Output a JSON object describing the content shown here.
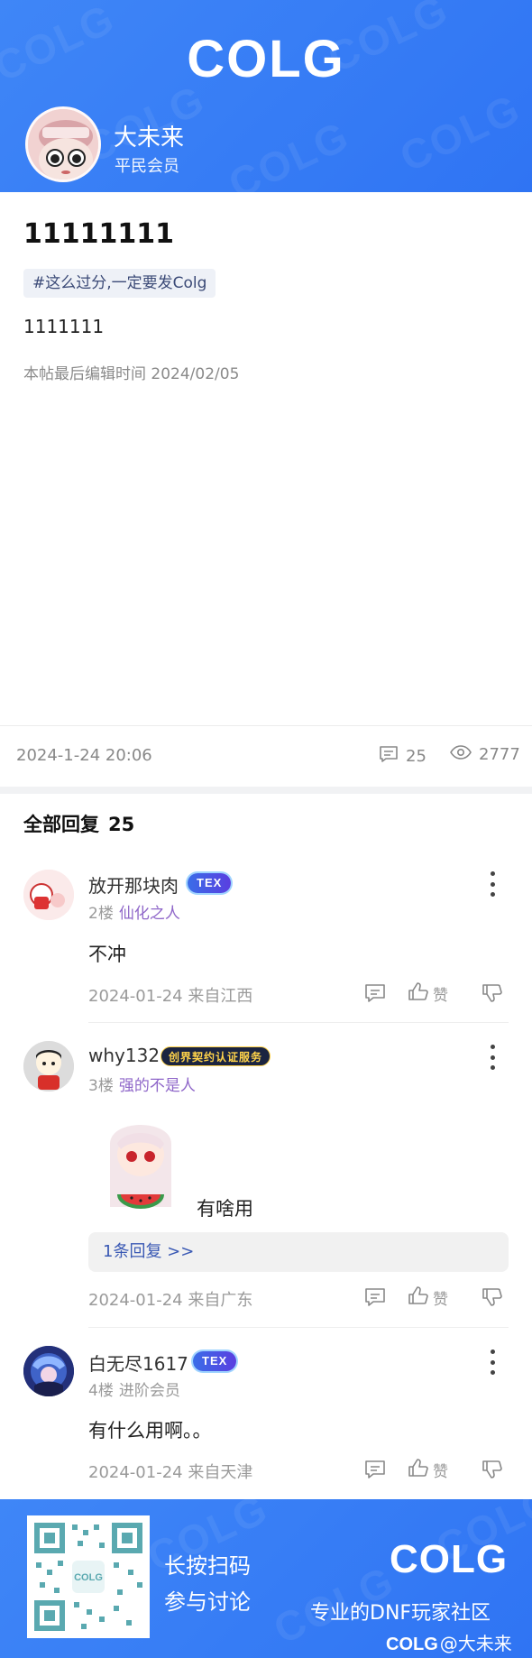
{
  "header": {
    "logo": "COLG",
    "author_name": "大未来",
    "author_rank": "平民会员"
  },
  "post": {
    "title": "11111111",
    "topic_tag": "#这么过分,一定要发Colg",
    "body": "1111111",
    "edited": "本帖最后编辑时间 2024/02/05",
    "date": "2024-1-24 20:06",
    "comment_count": "25",
    "view_count": "2777"
  },
  "replies_section": {
    "label": "全部回复",
    "count": "25"
  },
  "replies": [
    {
      "name": "放开那块肉",
      "badge": "TEX",
      "floor": "2楼",
      "title": "仙化之人",
      "text": "不冲",
      "foot": "2024-01-24 来自江西",
      "like_label": "赞"
    },
    {
      "name": "why132",
      "badge": "创界契约认证服务",
      "floor": "3楼",
      "title": "强的不是人",
      "text": "有啥用",
      "subreply": "1条回复 >>",
      "foot": "2024-01-24 来自广东",
      "like_label": "赞"
    },
    {
      "name": "白无尽1617",
      "badge": "TEX",
      "floor": "4楼",
      "title": "进阶会员",
      "text": "有什么用啊。。",
      "foot": "2024-01-24 来自天津",
      "like_label": "赞"
    }
  ],
  "footer": {
    "cta_line1": "长按扫码",
    "cta_line2": "参与讨论",
    "logo": "COLG",
    "slogan": "专业的DNF玩家社区",
    "credit_logo": "COLG",
    "credit_user": "@大未来"
  },
  "colors": {
    "brand_blue": "#3478f6",
    "title_purple": "#8f67c9",
    "link_blue": "#3a59b4"
  }
}
